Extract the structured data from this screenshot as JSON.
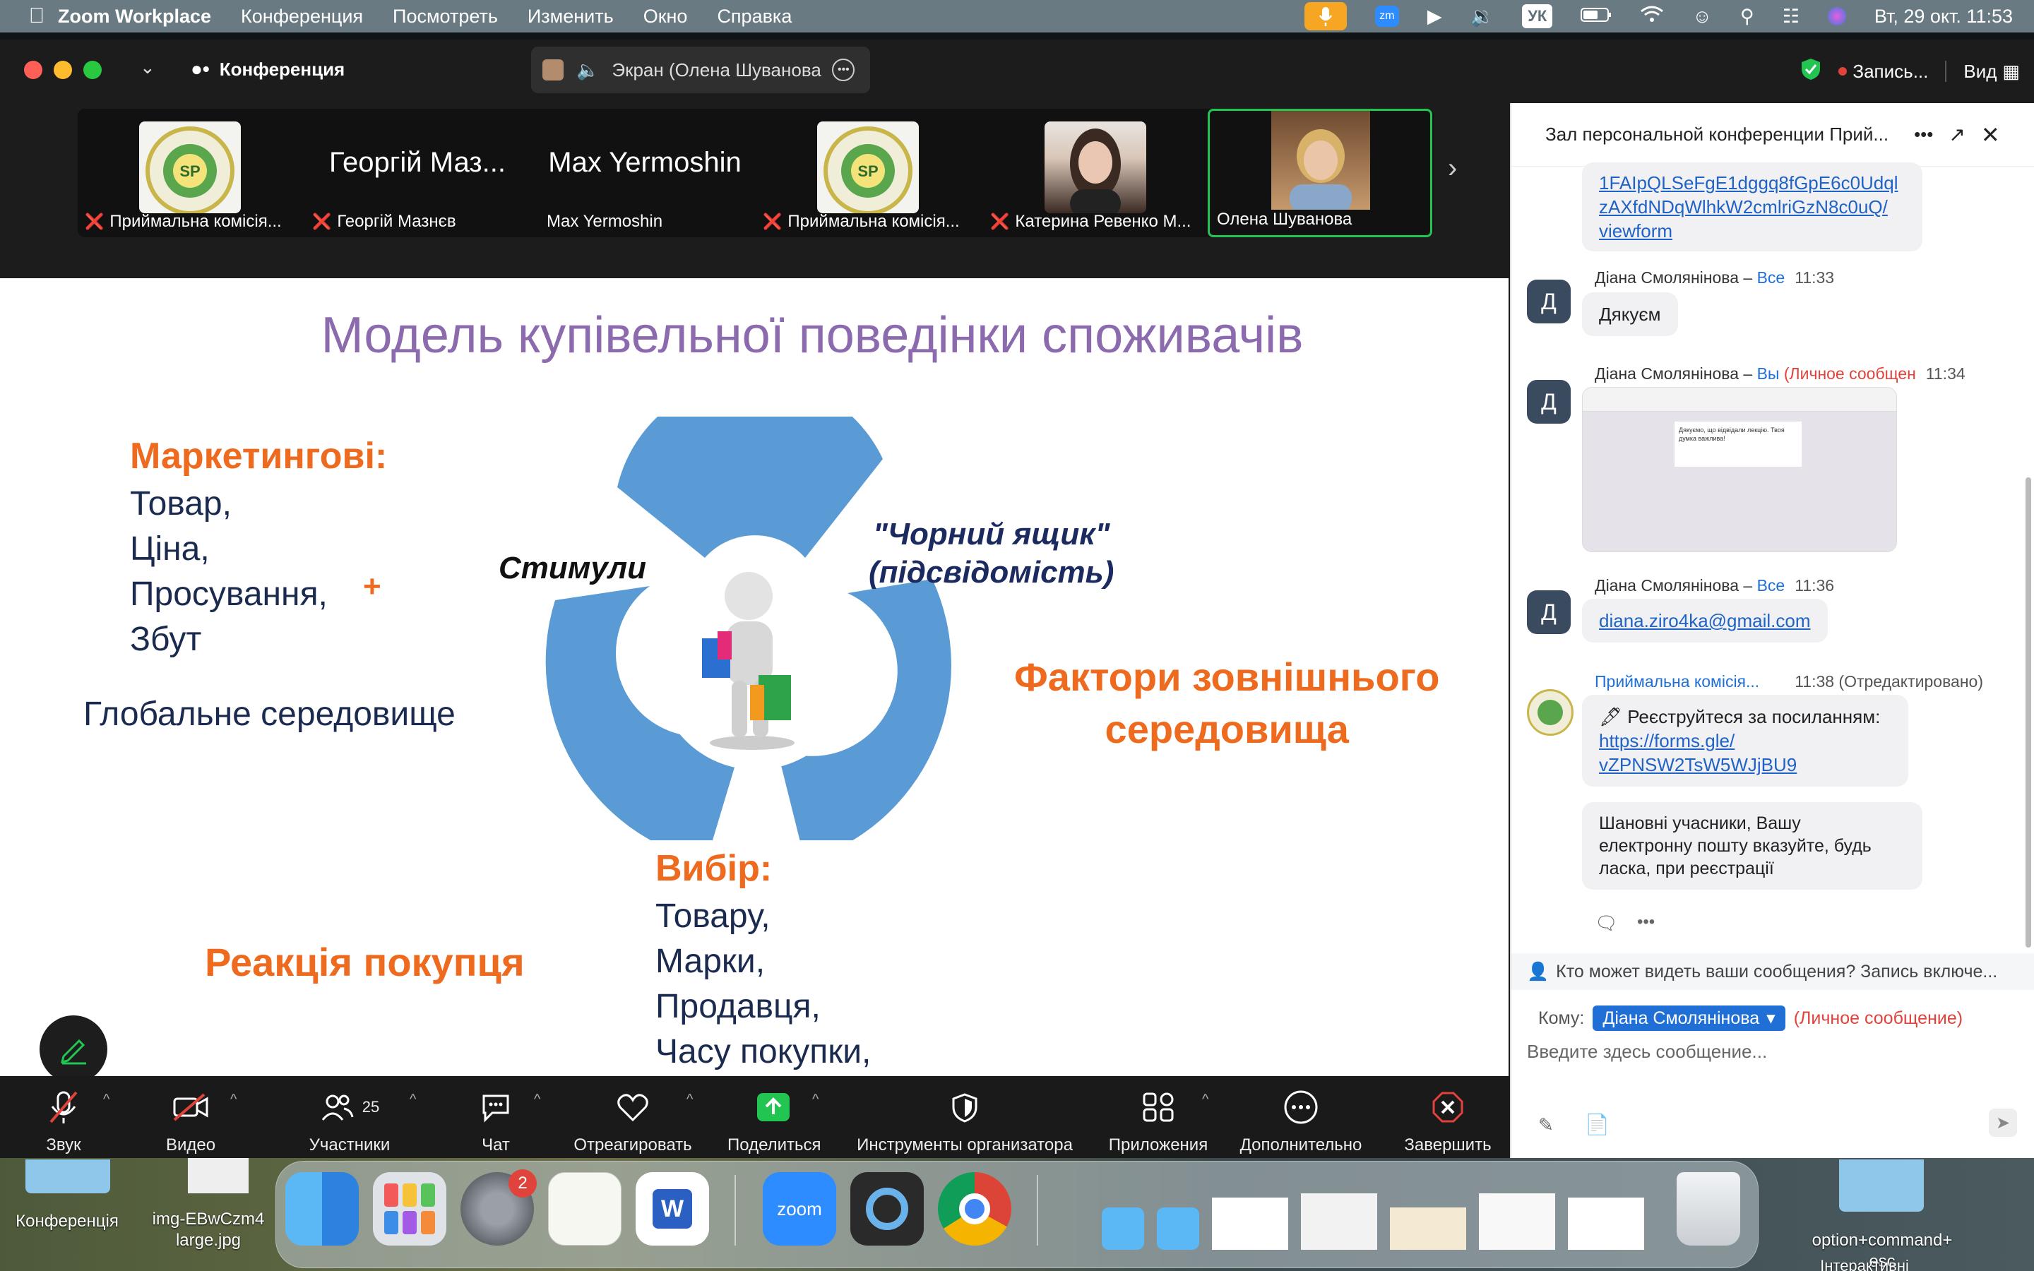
{
  "menubar": {
    "app": "Zoom Workplace",
    "items": [
      "Конференция",
      "Посмотреть",
      "Изменить",
      "Окно",
      "Справка"
    ],
    "keyboard": "УК",
    "datetime": "Вт, 29 окт.  11:53"
  },
  "window": {
    "title": "Конференция",
    "share_label": "Экран (Олена Шуванова",
    "recording": "Запись...",
    "view": "Вид"
  },
  "gallery": [
    {
      "name": "Приймальна комісія...",
      "muted": true,
      "type": "logo"
    },
    {
      "name": "Георгій Мазнєв",
      "muted": true,
      "type": "text",
      "big": "Георгій Маз..."
    },
    {
      "name": "Max Yermoshin",
      "muted": false,
      "type": "text",
      "big": "Max Yermoshin"
    },
    {
      "name": "Приймальна комісія...",
      "muted": true,
      "type": "logo"
    },
    {
      "name": "Катерина Ревенко М...",
      "muted": true,
      "type": "photo"
    },
    {
      "name": "Олена Шуванова",
      "muted": false,
      "type": "photo-active"
    }
  ],
  "slide": {
    "title": "Модель купівельної поведінки споживачів",
    "marketing_head": "Маркетингові:",
    "marketing_items": [
      "Товар,",
      "Ціна,",
      "Просування,",
      "Збут"
    ],
    "plus": "+",
    "global": "Глобальне  середовище",
    "stimuli": "Стимули",
    "black_box_1": "\"Чорний ящик\"",
    "black_box_2": "(підсвідомість)",
    "factors_1": "Фактори зовнішнього",
    "factors_2": "середовища",
    "choice_head": "Вибір:",
    "choice_items": [
      "Товару,",
      "Марки,",
      "Продавця,",
      "Часу покупки,"
    ],
    "reaction": "Реакція покупця"
  },
  "toolbar": {
    "audio": "Звук",
    "video": "Видео",
    "participants": "Участники",
    "participants_count": "25",
    "chat": "Чат",
    "react": "Отреагировать",
    "share": "Поделиться",
    "host_tools": "Инструменты организатора",
    "apps": "Приложения",
    "more": "Дополнительно",
    "end": "Завершить"
  },
  "chat": {
    "title": "Зал персональной конференции Прий...",
    "link_top": [
      "1FAIpQLSeFgE1dggq8fGpE6c0Udql",
      "zAXfdNDqWlhkW2cmlriGzN8c0uQ/",
      "viewform"
    ],
    "messages": [
      {
        "sender": "Діана Смолянінова",
        "sep": " – ",
        "to": "Все",
        "time": "11:33",
        "text": "Дякуєм"
      },
      {
        "sender": "Діана Смолянінова",
        "sep": " – ",
        "to": "Вы",
        "private": "(Личное сообщен",
        "time": "11:34",
        "image": true
      },
      {
        "sender": "Діана Смолянінова",
        "sep": " – ",
        "to": "Все",
        "time": "11:36",
        "text": "diana.ziro4ka@gmail.com"
      },
      {
        "sender": "Приймальна комісія...",
        "time": "11:38 (Отредактировано)"
      }
    ],
    "reg_text": "🖋 Реєструйтеся за посиланням:",
    "reg_link_1": "https://forms.gle/",
    "reg_link_2": "vZPNSW2TsW5WJjBU9",
    "note_1": "Шановні учасники, Вашу",
    "note_2": "електронну пошту вказуйте, будь",
    "note_3": "ласка, при реєстрації",
    "screenshot_text_1": "Дякуємо, що відвідали лекцію. Твоя",
    "screenshot_text_2": "думка важлива!",
    "visibility": "Кто может видеть ваши сообщения? Запись включе...",
    "to_label": "Кому:",
    "to_value": "Діана Смолянінова",
    "to_private": "(Личное сообщение)",
    "placeholder": "Введите здесь сообщение..."
  },
  "desktop": {
    "left_label_1": "Конференція",
    "file_label_1": "img-EBwCzm4",
    "file_label_2": "large.jpg",
    "right_label_1": "option+command+",
    "right_label_2": "esc",
    "bottom_cut": "Інтерактивні",
    "dock_badge": "2",
    "zoom_label": "zoom"
  }
}
